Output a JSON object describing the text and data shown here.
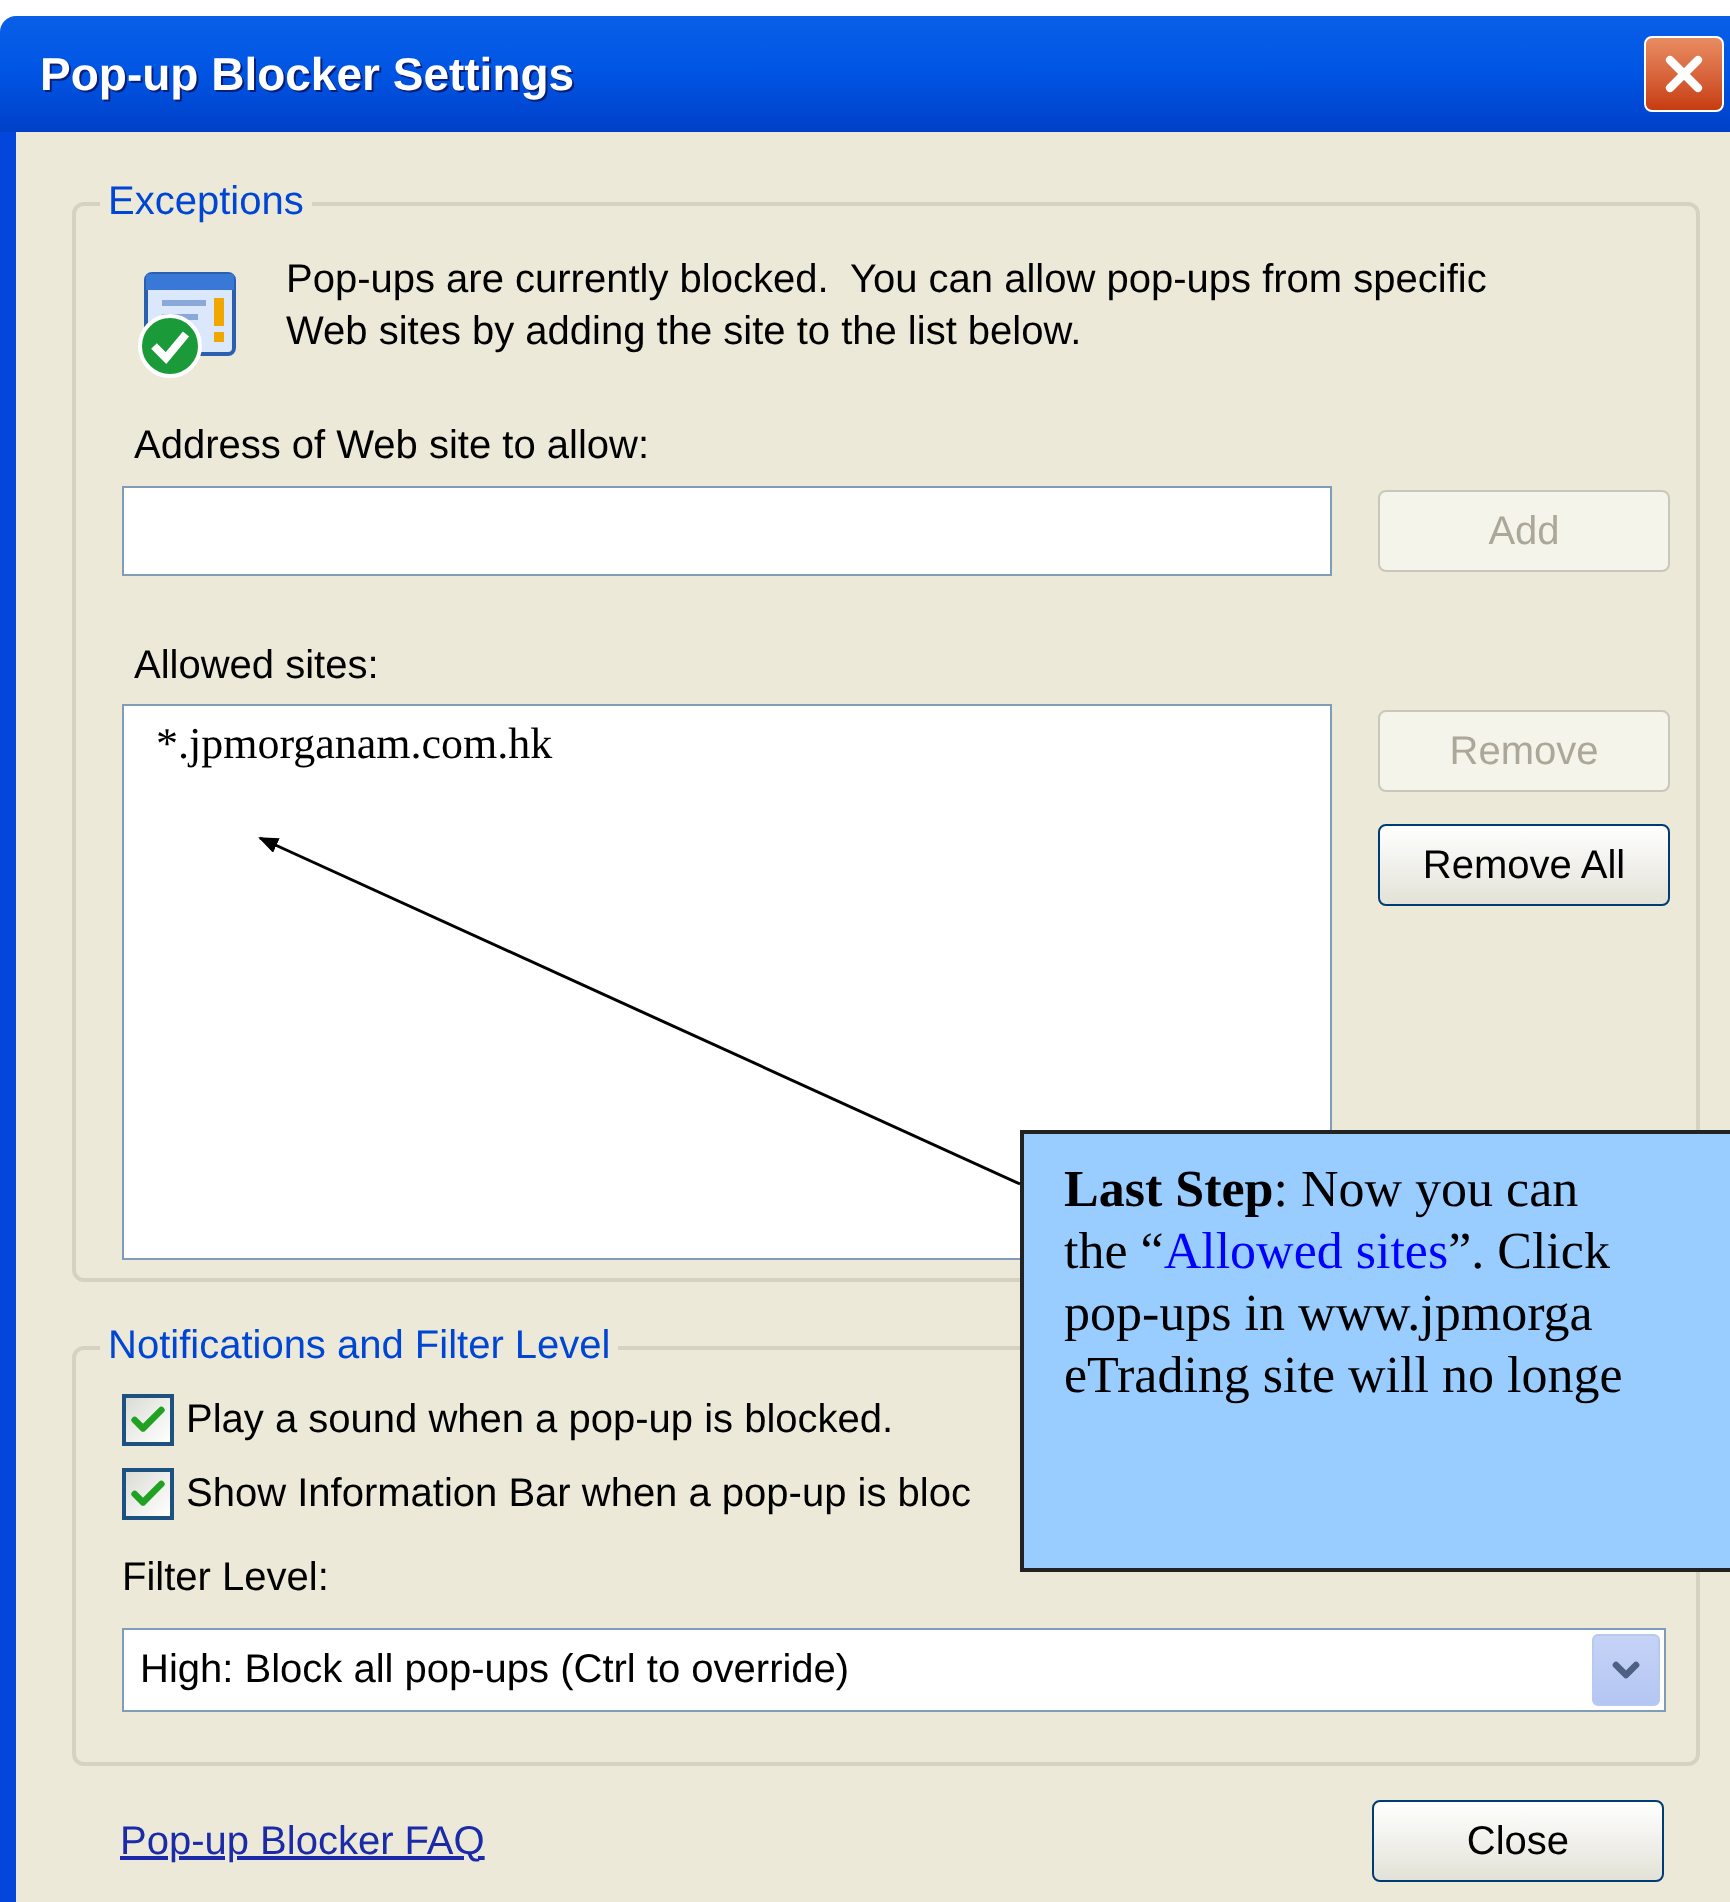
{
  "window": {
    "title": "Pop-up Blocker Settings"
  },
  "exceptions": {
    "legend": "Exceptions",
    "message": "Pop-ups are currently blocked.  You can allow pop-ups from specific Web sites by adding the site to the list below.",
    "address_label": "Address of Web site to allow:",
    "add_button": {
      "label": "Add",
      "disabled": true
    },
    "allowed_label": "Allowed sites:",
    "allowed_sites": [
      {
        "text": "*.jpmorganam.com.hk",
        "selected": false
      }
    ],
    "remove_button": {
      "label": "Remove",
      "disabled": true
    },
    "remove_all_button": {
      "label": "Remove All",
      "disabled": false
    }
  },
  "notifications": {
    "legend": "Notifications and Filter Level",
    "options": [
      {
        "label": "Play a sound when a pop-up is blocked.",
        "checked": true
      },
      {
        "label": "Show Information Bar when a pop-up is bloc",
        "checked": true
      }
    ],
    "filter_label": "Filter Level:",
    "filter_value": "High: Block all pop-ups (Ctrl to override)"
  },
  "faq_link": "Pop-up Blocker FAQ",
  "close_button": {
    "label": "Close",
    "disabled": false
  },
  "callout": {
    "lines": [
      [
        {
          "text": "Last Step",
          "kind": "bold"
        },
        {
          "text": ":  Now you can",
          "kind": "plain"
        }
      ],
      [
        {
          "text": "the “",
          "kind": "plain"
        },
        {
          "text": "Allowed sites",
          "kind": "link"
        },
        {
          "text": "”. Click",
          "kind": "plain"
        }
      ],
      [
        {
          "text": "pop-ups in www.jpmorga",
          "kind": "plain"
        }
      ],
      [
        {
          "text": "eTrading site will no longe",
          "kind": "plain"
        }
      ]
    ]
  }
}
